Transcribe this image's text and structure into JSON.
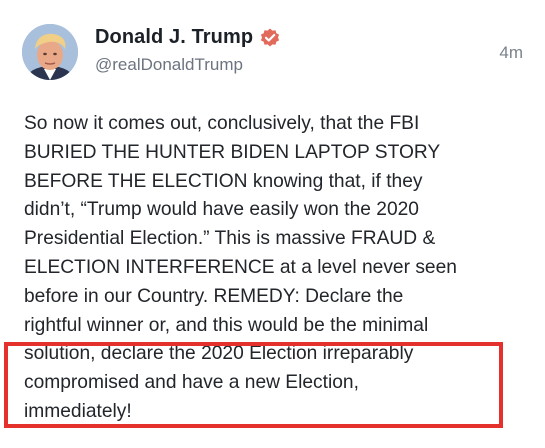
{
  "post": {
    "author_name": "Donald J. Trump",
    "handle": "@realDonaldTrump",
    "timestamp": "4m",
    "verified_icon": "verified-badge-icon",
    "accent_color": "#e26a5b",
    "body_lines": [
      "So now it comes out, conclusively, that the FBI",
      "BURIED THE HUNTER BIDEN LAPTOP STORY",
      "BEFORE THE ELECTION knowing that, if they",
      "didn’t, “Trump would have easily won the 2020",
      "Presidential Election.” This is massive FRAUD &",
      "ELECTION INTERFERENCE at a level never seen",
      "before in our Country. REMEDY: Declare the",
      "rightful winner or, and this would be the minimal",
      "solution, declare the 2020 Election irreparably",
      "compromised and have a new Election,",
      "immediately!"
    ]
  },
  "annotation": {
    "highlight_color": "#e5312b"
  }
}
